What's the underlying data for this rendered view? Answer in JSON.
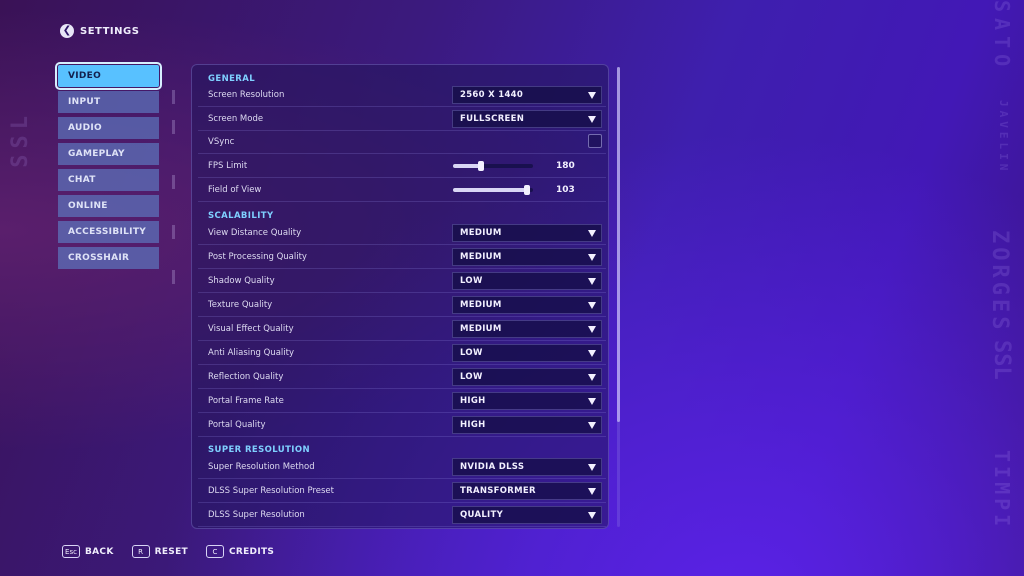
{
  "header": {
    "title": "SETTINGS"
  },
  "nav": {
    "items": [
      {
        "label": "VIDEO",
        "active": true
      },
      {
        "label": "INPUT"
      },
      {
        "label": "AUDIO"
      },
      {
        "label": "GAMEPLAY"
      },
      {
        "label": "CHAT"
      },
      {
        "label": "ONLINE"
      },
      {
        "label": "ACCESSIBILITY"
      },
      {
        "label": "CROSSHAIR"
      }
    ]
  },
  "general": {
    "title": "GENERAL",
    "screen_resolution": {
      "label": "Screen Resolution",
      "value": "2560 X 1440"
    },
    "screen_mode": {
      "label": "Screen Mode",
      "value": "FULLSCREEN"
    },
    "vsync": {
      "label": "VSync",
      "checked": false
    },
    "fps_limit": {
      "label": "FPS Limit",
      "value": "180",
      "fraction": 0.35
    },
    "fov": {
      "label": "Field of View",
      "value": "103",
      "fraction": 0.93
    }
  },
  "scalability": {
    "title": "SCALABILITY",
    "rows": [
      {
        "label": "View Distance Quality",
        "value": "MEDIUM"
      },
      {
        "label": "Post Processing Quality",
        "value": "MEDIUM"
      },
      {
        "label": "Shadow Quality",
        "value": "LOW"
      },
      {
        "label": "Texture Quality",
        "value": "MEDIUM"
      },
      {
        "label": "Visual Effect Quality",
        "value": "MEDIUM"
      },
      {
        "label": "Anti Aliasing Quality",
        "value": "LOW"
      },
      {
        "label": "Reflection Quality",
        "value": "LOW"
      },
      {
        "label": "Portal Frame Rate",
        "value": "HIGH"
      },
      {
        "label": "Portal Quality",
        "value": "HIGH"
      }
    ]
  },
  "super_resolution": {
    "title": "SUPER RESOLUTION",
    "rows": [
      {
        "label": "Super Resolution Method",
        "value": "NVIDIA DLSS"
      },
      {
        "label": "DLSS Super Resolution Preset",
        "value": "TRANSFORMER"
      },
      {
        "label": "DLSS Super Resolution",
        "value": "QUALITY"
      }
    ]
  },
  "footer": {
    "back": {
      "key": "Esc",
      "label": "BACK"
    },
    "reset": {
      "key": "R",
      "label": "RESET"
    },
    "credits": {
      "key": "C",
      "label": "CREDITS"
    }
  },
  "decor": {
    "left_text": "SSL",
    "right_top": "SATO",
    "right_mid": "JAVELIN",
    "right_low": "ZORGES",
    "right_low2": "SSL",
    "right_bottom": "TIMPI"
  },
  "colors": {
    "accent": "#58c1ff",
    "section": "#7fd0ff",
    "nav_bg": "#5c76be"
  }
}
